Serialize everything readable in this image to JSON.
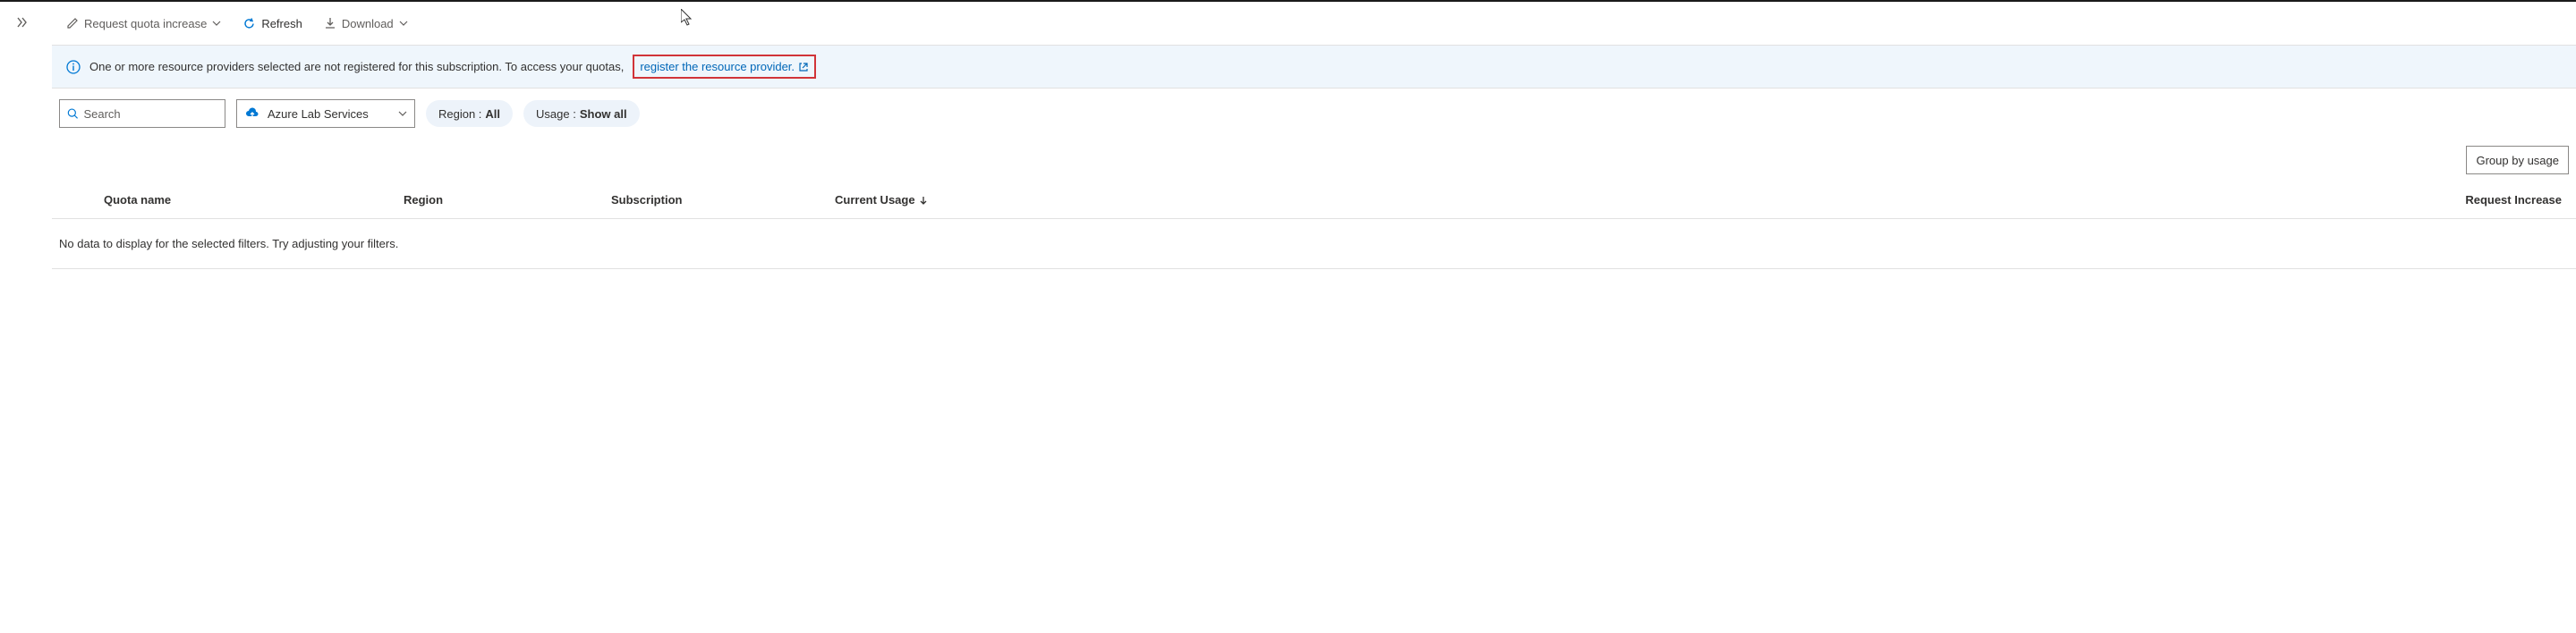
{
  "toolbar": {
    "request_increase_label": "Request quota increase",
    "refresh_label": "Refresh",
    "download_label": "Download"
  },
  "info_banner": {
    "message": "One or more resource providers selected are not registered for this subscription. To access your quotas,",
    "link_text": "register the resource provider."
  },
  "filters": {
    "search_placeholder": "Search",
    "provider_label": "Azure Lab Services",
    "region_label": "Region :",
    "region_value": "All",
    "usage_label": "Usage :",
    "usage_value": "Show all"
  },
  "group_by": {
    "label": "Group by usage"
  },
  "table": {
    "headers": {
      "quota_name": "Quota name",
      "region": "Region",
      "subscription": "Subscription",
      "current_usage": "Current Usage",
      "request_increase": "Request Increase"
    },
    "empty_text": "No data to display for the selected filters. Try adjusting your filters."
  }
}
